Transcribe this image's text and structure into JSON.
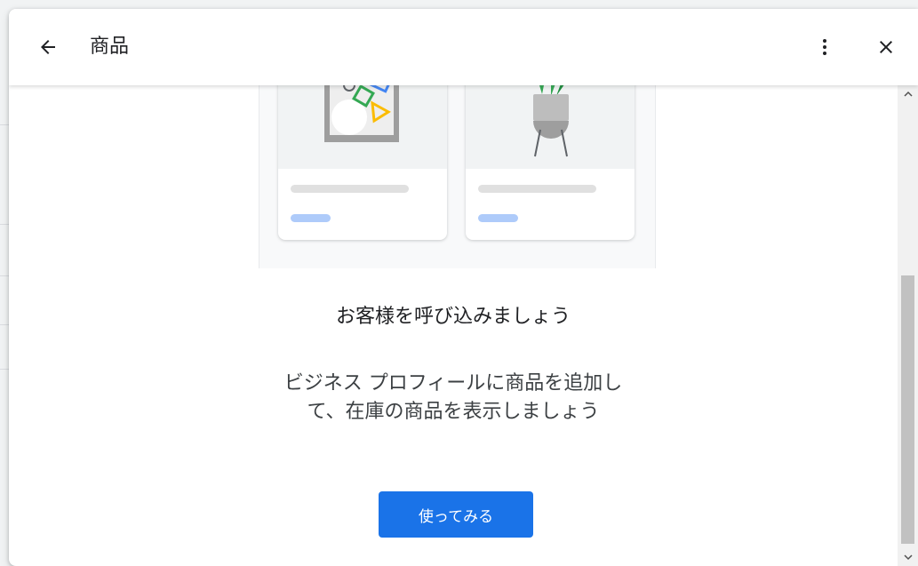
{
  "header": {
    "title": "商品",
    "back_icon": "arrow-back-icon",
    "menu_icon": "more-vert-icon",
    "close_icon": "close-icon"
  },
  "illustration": {
    "card_left_image": "abstract-shapes-picture",
    "card_right_image": "potted-plant"
  },
  "main": {
    "headline": "お客様を呼び込みましょう",
    "body_line1": "ビジネス プロフィールに商品を追加し",
    "body_line2": "て、在庫の商品を表示しましょう",
    "cta_label": "使ってみる"
  },
  "colors": {
    "accent": "#1a73e8",
    "placeholder_blue": "#aecbfa",
    "placeholder_grey": "#e0e0e0"
  }
}
